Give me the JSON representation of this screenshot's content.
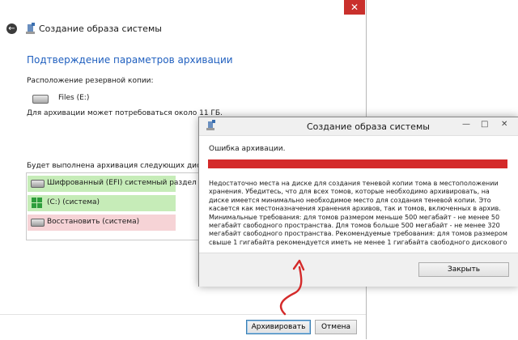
{
  "main_window": {
    "title": "Создание образа системы",
    "heading": "Подтверждение параметров архивации",
    "backup_location_label": "Расположение резервной копии:",
    "backup_drive": "Files (E:)",
    "space_note": "Для архивации может потребоваться около 11 ГБ.",
    "disks_label": "Будет выполнена архивация следующих дисков:",
    "disks": [
      {
        "label": "Шифрованный (EFI) системный раздел",
        "state": "green"
      },
      {
        "label": "(C:) (система)",
        "state": "green"
      },
      {
        "label": "Восстановить (система)",
        "state": "pink"
      }
    ],
    "archive_button": "Архивировать",
    "cancel_button": "Отмена",
    "close_glyph": "✕"
  },
  "error_dialog": {
    "title": "Создание образа системы",
    "error_heading": "Ошибка архивации.",
    "message": "Недостаточно места на диске для создания теневой копии тома в местоположении хранения. Убедитесь, что для всех томов, которые необходимо архивировать, на диске имеется минимально необходимое место для создания теневой копии. Это касается как местоназначения хранения архивов, так и томов, включенных в архив. Минимальные требования: для томов размером меньше 500 мегабайт - не менее 50 мегабайт свободного пространства. Для томов больше 500 мегабайт - не менее 320 мегабайт свободного пространства. Рекомендуемые требования: для томов размером свыше 1 гигабайта рекомендуется иметь не менее 1 гигабайта свободного дискового пространства для каждого",
    "close_button": "Закрыть",
    "window_buttons": {
      "minimize": "—",
      "maximize": "□",
      "close": "✕"
    }
  },
  "colors": {
    "accent_heading": "#1f5fbf",
    "error_bar": "#d42a2a",
    "close_red": "#c9302c",
    "disk_ok": "#c6ecb8",
    "disk_warn": "#f6d3d6"
  }
}
